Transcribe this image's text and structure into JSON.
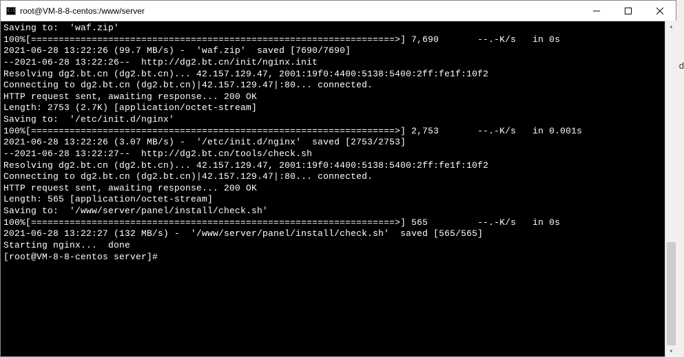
{
  "titlebar": {
    "title": "root@VM-8-8-centos:/www/server"
  },
  "terminal": {
    "lines": [
      "Saving to:  'waf.zip'",
      "",
      "100%[==================================================================>] 7,690       --.-K/s   in 0s",
      "",
      "2021-06-28 13:22:26 (99.7 MB/s) -  'waf.zip'  saved [7690/7690]",
      "",
      "--2021-06-28 13:22:26--  http://dg2.bt.cn/init/nginx.init",
      "Resolving dg2.bt.cn (dg2.bt.cn)... 42.157.129.47, 2001:19f0:4400:5138:5400:2ff:fe1f:10f2",
      "Connecting to dg2.bt.cn (dg2.bt.cn)|42.157.129.47|:80... connected.",
      "HTTP request sent, awaiting response... 200 OK",
      "Length: 2753 (2.7K) [application/octet-stream]",
      "Saving to:  '/etc/init.d/nginx'",
      "",
      "100%[==================================================================>] 2,753       --.-K/s   in 0.001s",
      "",
      "2021-06-28 13:22:26 (3.07 MB/s) -  '/etc/init.d/nginx'  saved [2753/2753]",
      "",
      "--2021-06-28 13:22:27--  http://dg2.bt.cn/tools/check.sh",
      "Resolving dg2.bt.cn (dg2.bt.cn)... 42.157.129.47, 2001:19f0:4400:5138:5400:2ff:fe1f:10f2",
      "Connecting to dg2.bt.cn (dg2.bt.cn)|42.157.129.47|:80... connected.",
      "HTTP request sent, awaiting response... 200 OK",
      "Length: 565 [application/octet-stream]",
      "Saving to:  '/www/server/panel/install/check.sh'",
      "",
      "100%[==================================================================>] 565         --.-K/s   in 0s",
      "",
      "2021-06-28 13:22:27 (132 MB/s) -  '/www/server/panel/install/check.sh'  saved [565/565]",
      "",
      "Starting nginx...  done"
    ],
    "prompt": "[root@VM-8-8-centos server]#"
  },
  "side_char": "d"
}
